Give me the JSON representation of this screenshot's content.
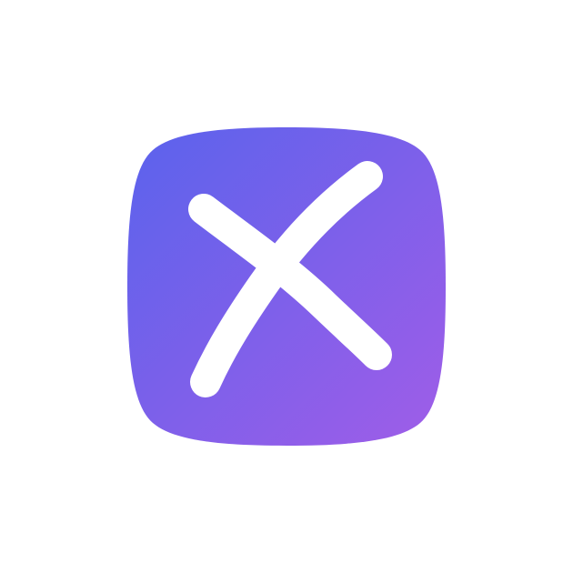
{
  "icon": {
    "name": "close-x-icon",
    "gradient_start": "#5A63EC",
    "gradient_end": "#A05DE8",
    "glyph_color": "#FFFFFF",
    "background_color": "#FFFFFF"
  }
}
